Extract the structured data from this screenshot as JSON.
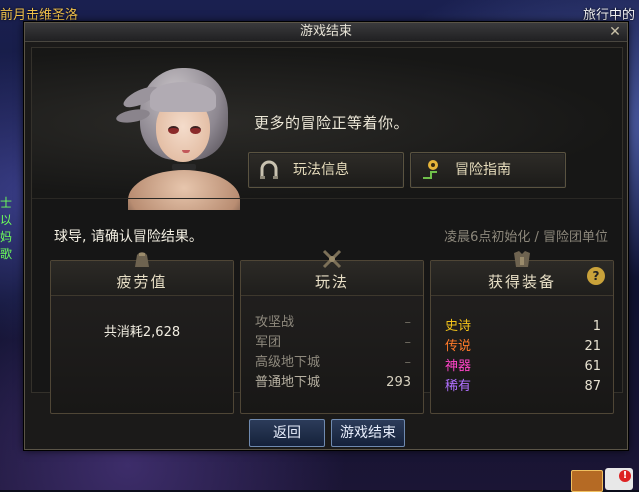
{
  "background": {
    "left_text": "前月击维圣洛",
    "right_text": "旅行中的",
    "side_chars": [
      "士",
      "以",
      "妈",
      "歌"
    ]
  },
  "dialog": {
    "title": "游戏结束",
    "close_glyph": "✕",
    "tagline": "更多的冒险正等着你。",
    "btn_info": "玩法信息",
    "btn_guide": "冒险指南",
    "confirm_text": "球导, 请确认冒险结果。",
    "reset_text": "凌晨6点初始化 / 冒险团单位"
  },
  "panels": {
    "fatigue": {
      "title": "疲劳值",
      "text": "共消耗2,628"
    },
    "modes": {
      "title": "玩法",
      "rows": [
        {
          "name": "攻坚战",
          "value": "–"
        },
        {
          "name": "军团",
          "value": "–"
        },
        {
          "name": "高级地下城",
          "value": "–"
        },
        {
          "name": "普通地下城",
          "value": "293"
        }
      ]
    },
    "equipment": {
      "title": "获得装备",
      "help": "?",
      "rows": [
        {
          "name": "史诗",
          "value": "1",
          "color": "#f3c41a"
        },
        {
          "name": "传说",
          "value": "21",
          "color": "#ff7a2a"
        },
        {
          "name": "神器",
          "value": "61",
          "color": "#ff44c8"
        },
        {
          "name": "稀有",
          "value": "87",
          "color": "#b070ff"
        }
      ]
    }
  },
  "footer": {
    "back": "返回",
    "end": "游戏结束"
  }
}
